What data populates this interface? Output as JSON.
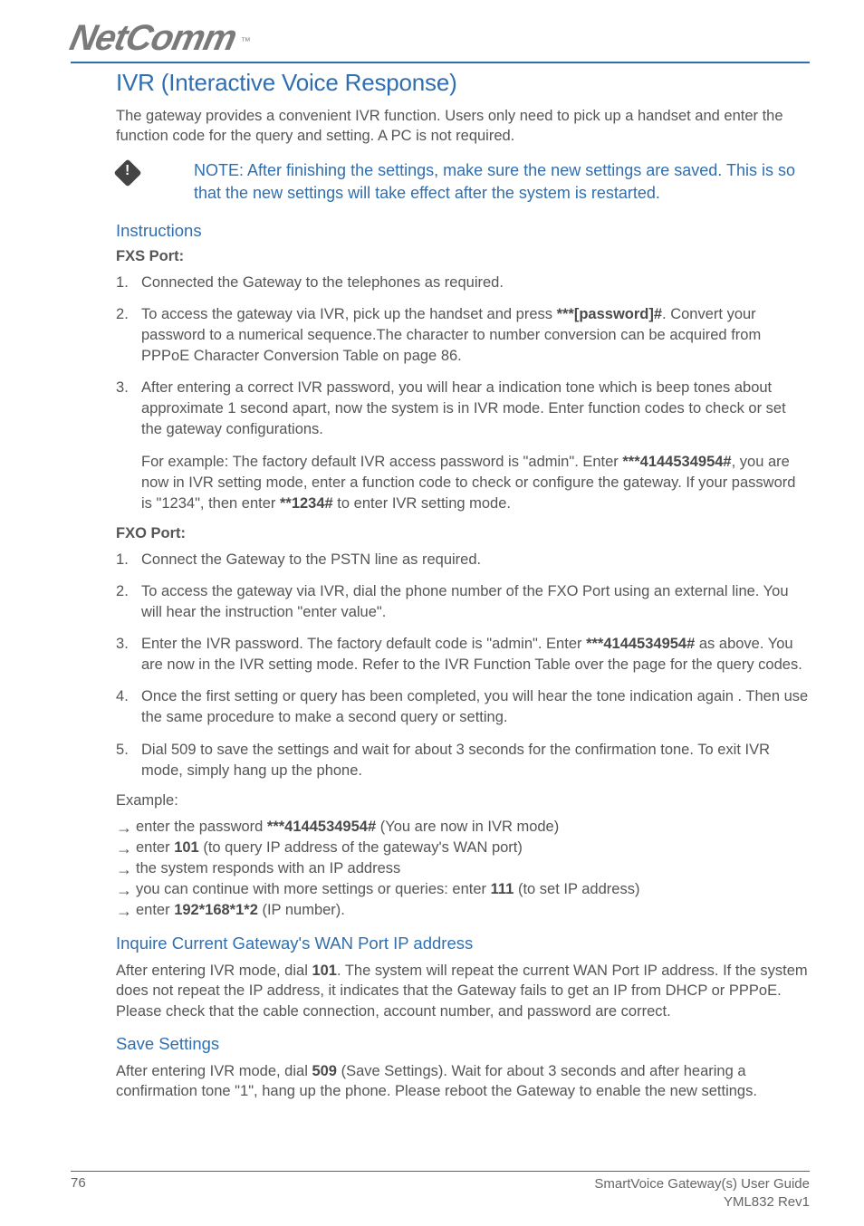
{
  "logo": {
    "text": "NetComm",
    "tm": "™"
  },
  "h1": "IVR (Interactive Voice Response)",
  "intro": "The gateway provides a convenient IVR function. Users only need to pick up a handset and enter the function code for the query and setting.  A PC is not required.",
  "note": "NOTE: After finishing the settings, make sure the new settings are saved. This is so that the new settings will take effect after the system is restarted.",
  "instructions_h": "Instructions",
  "fxs_h": "FXS Port:",
  "fxs_steps": {
    "s1": "Connected the Gateway to the telephones as required.",
    "s2a": "To access the gateway via IVR, pick up the handset and press ",
    "s2b": "***[password]#",
    "s2c": ". Convert your password to a numerical sequence.The character to number conversion can be acquired from PPPoE Character Conversion Table on page 86.",
    "s3": "After entering a correct IVR password, you will hear a indication tone which is beep tones about approximate 1 second apart, now the system is in IVR mode. Enter function codes to check or set the gateway configurations.",
    "s3_sub_a": "For example: The factory default IVR access password is \"admin\". Enter ",
    "s3_sub_b": "***4144534954#",
    "s3_sub_c": ", you are now in IVR setting mode, enter a function code to check or configure the gateway. If your password is \"1234\", then enter ",
    "s3_sub_d": "**1234#",
    "s3_sub_e": " to enter IVR setting mode."
  },
  "fxo_h": "FXO Port:",
  "fxo_steps": {
    "s1": "Connect the Gateway to the PSTN line as required.",
    "s2": "To access the gateway via IVR, dial the phone number of the FXO Port using an external line. You will hear the instruction \"enter value\".",
    "s3a": "Enter the IVR password. The factory default code is \"admin\". Enter ",
    "s3b": "***4144534954#",
    "s3c": " as above. You are now in the IVR setting mode.  Refer to the IVR Function Table over the page for the query codes.",
    "s4": "Once the first setting or query has been completed, you will hear the tone indication again . Then use the same procedure to make a second query or setting.",
    "s5": "Dial 509 to save the settings and wait for about 3 seconds for the confirmation tone.  To exit IVR mode, simply hang up the phone."
  },
  "example_label": "Example:",
  "example_lines": {
    "l1a": "enter the password ",
    "l1b": "***4144534954#",
    "l1c": " (You are now in IVR mode)",
    "l2a": "enter ",
    "l2b": "101",
    "l2c": " (to query IP address of the gateway's WAN port)",
    "l3": "the system responds with an IP address",
    "l4a": "you can continue with more settings or queries: enter ",
    "l4b": "111",
    "l4c": " (to set IP address)",
    "l5a": "enter ",
    "l5b": "192*168*1*2",
    "l5c": " (IP number)."
  },
  "inquire_h": "Inquire Current Gateway's WAN Port IP address",
  "inquire_p_a": "After entering IVR mode, dial ",
  "inquire_p_b": "101",
  "inquire_p_c": ". The system will repeat the current WAN Port IP address.  If the system does not repeat the IP address, it indicates that the Gateway fails to get an IP from DHCP or PPPoE. Please check that the cable connection, account number, and password are correct.",
  "save_h": "Save Settings",
  "save_p_a": "After entering IVR mode, dial ",
  "save_p_b": "509",
  "save_p_c": " (Save Settings). Wait for about 3 seconds and after hearing a confirmation tone \"1\", hang up the phone. Please reboot the Gateway to enable the new settings.",
  "footer": {
    "page": "76",
    "guide": "SmartVoice Gateway(s) User Guide",
    "rev": "YML832 Rev1"
  }
}
